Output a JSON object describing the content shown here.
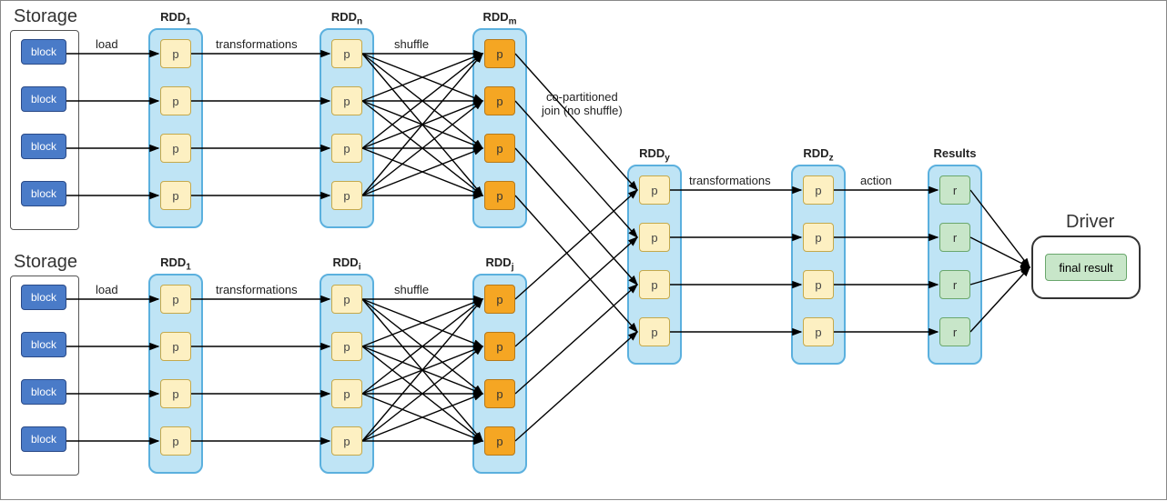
{
  "titles": {
    "storage1": "Storage",
    "storage2": "Storage",
    "driver": "Driver"
  },
  "headers": {
    "rdd1a": "RDD<sub>1</sub>",
    "rddn": "RDD<sub>n</sub>",
    "rddm": "RDD<sub>m</sub>",
    "rdd1b": "RDD<sub>1</sub>",
    "rddi": "RDD<sub>i</sub>",
    "rddj": "RDD<sub>j</sub>",
    "rddy": "RDD<sub>y</sub>",
    "rddz": "RDD<sub>z</sub>",
    "results": "Results"
  },
  "edge_labels": {
    "load": "load",
    "transformations": "transformations",
    "shuffle": "shuffle",
    "join": "co-partitioned\njoin (no shuffle)",
    "action": "action"
  },
  "cells": {
    "block": "block",
    "p": "p",
    "r": "r",
    "final": "final result"
  },
  "diagram": {
    "type": "data-flow",
    "description": "Spark RDD lineage / execution DAG",
    "pipelines": [
      {
        "name": "top",
        "stages": [
          "Storage(4 blocks)",
          "RDD1(4 p)",
          "RDDn(4 p)",
          "RDDm(4 p, shuffled)"
        ]
      },
      {
        "name": "bottom",
        "stages": [
          "Storage(4 blocks)",
          "RDD1(4 p)",
          "RDDi(4 p)",
          "RDDj(4 p, shuffled)"
        ]
      }
    ],
    "join": {
      "inputs": [
        "RDDm",
        "RDDj"
      ],
      "output": "RDDy",
      "note": "co-partitioned join (no shuffle)"
    },
    "tail": [
      "RDDy(4 p)",
      "RDDz(4 p)",
      "Results(4 r)",
      "Driver(final result)"
    ],
    "edges": [
      {
        "from": "Storage",
        "to": "RDD1",
        "label": "load",
        "pattern": "1:1"
      },
      {
        "from": "RDD1",
        "to": "RDDn / RDDi",
        "label": "transformations",
        "pattern": "1:1"
      },
      {
        "from": "RDDn",
        "to": "RDDm",
        "label": "shuffle",
        "pattern": "all-to-all"
      },
      {
        "from": "RDDi",
        "to": "RDDj",
        "label": "shuffle",
        "pattern": "all-to-all"
      },
      {
        "from": "RDDm+RDDj",
        "to": "RDDy",
        "label": "co-partitioned join (no shuffle)",
        "pattern": "pairwise 2:1"
      },
      {
        "from": "RDDy",
        "to": "RDDz",
        "label": "transformations",
        "pattern": "1:1"
      },
      {
        "from": "RDDz",
        "to": "Results",
        "label": "action",
        "pattern": "1:1"
      },
      {
        "from": "Results",
        "to": "Driver",
        "label": "",
        "pattern": "many:1"
      }
    ]
  }
}
